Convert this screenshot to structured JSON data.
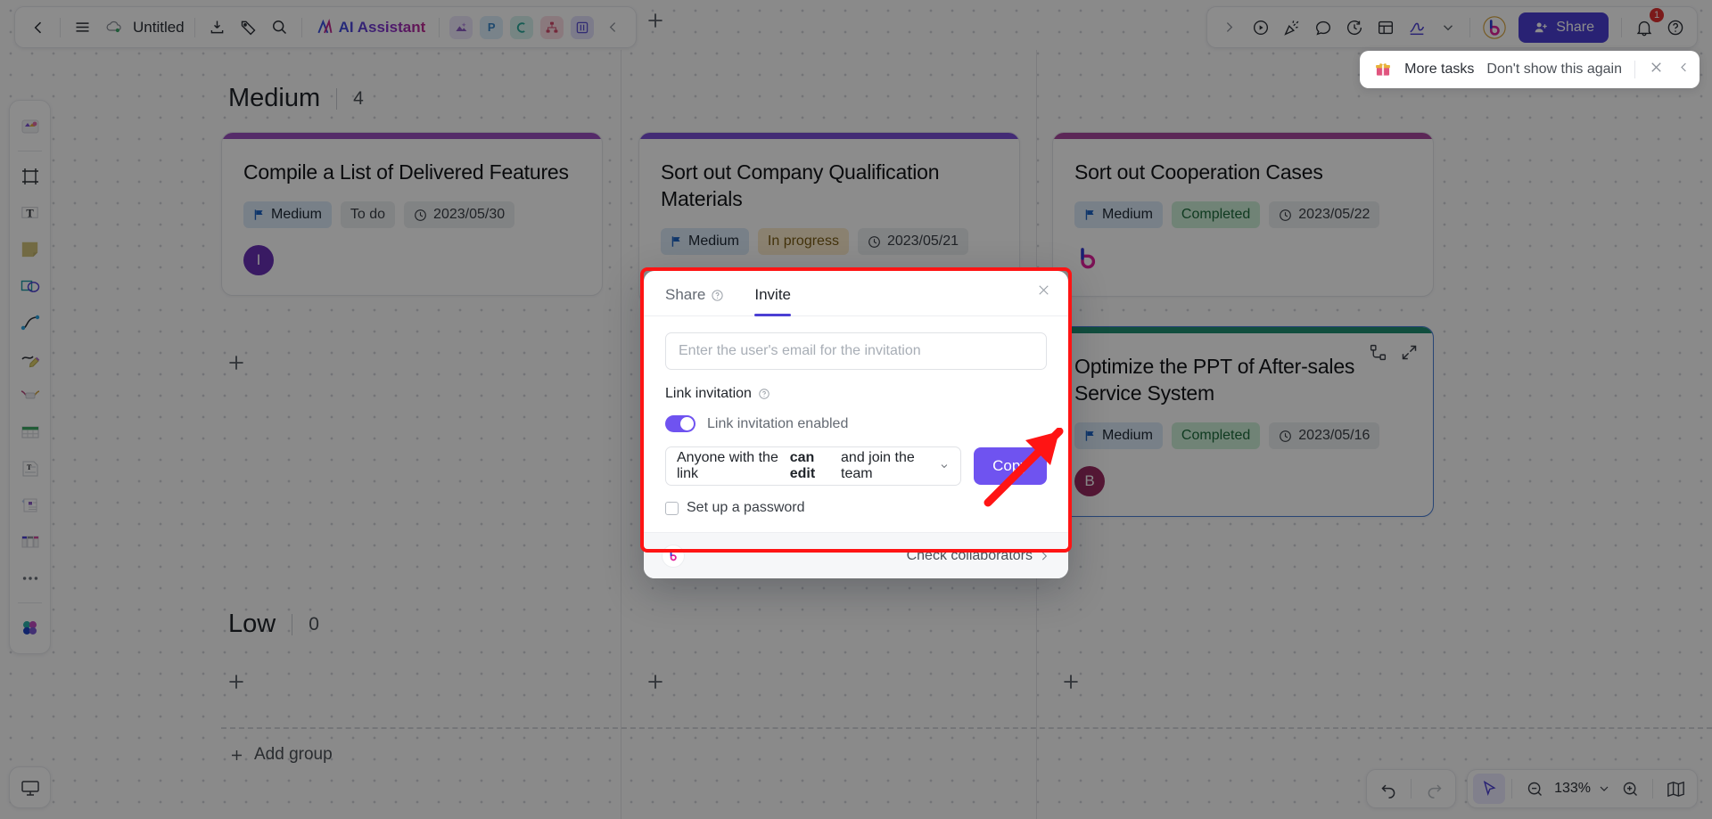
{
  "app": {
    "title": "Untitled",
    "zoom_level": "133%"
  },
  "topbar_left": {
    "back_icon": "chevron-left-icon",
    "menu_icon": "hamburger-menu-icon",
    "cloud_icon": "cloud-saved-icon",
    "title": "Untitled",
    "download_icon": "download-icon",
    "tag_icon": "tag-icon",
    "search_icon": "search-icon",
    "ai_label": "AI Assistant",
    "apps": [
      {
        "name": "image-app",
        "glyph": "▲",
        "bg": "#ede7fb",
        "fg": "#7a4fd1"
      },
      {
        "name": "ppt-app",
        "glyph": "P",
        "bg": "#ddeffb",
        "fg": "#3a86c8"
      },
      {
        "name": "mind-app",
        "glyph": "C",
        "bg": "#d8f2ee",
        "fg": "#2aa89a"
      },
      {
        "name": "flow-app",
        "glyph": "∴",
        "bg": "#fbdde4",
        "fg": "#d1496b"
      },
      {
        "name": "board-app",
        "glyph": "▥",
        "bg": "#e2e1fb",
        "fg": "#5a4fd4"
      }
    ],
    "collapse_icon": "chevron-left-icon"
  },
  "topbar_right": {
    "expand_icon": "chevron-right-icon",
    "icons": [
      {
        "name": "present-play-icon"
      },
      {
        "name": "celebrate-icon"
      },
      {
        "name": "comment-icon"
      },
      {
        "name": "history-icon"
      },
      {
        "name": "template-icon"
      },
      {
        "name": "pen-signature-icon"
      },
      {
        "name": "chevron-down-icon"
      }
    ],
    "brand_icon": "boardmix-logo-icon",
    "share_label": "Share",
    "share_icon": "person-add-icon",
    "notification_icon": "bell-icon",
    "notification_count": "1",
    "help_icon": "question-help-icon"
  },
  "toast": {
    "gift_icon": "gift-icon",
    "label": "More tasks",
    "dismiss_label": "Don't show this again",
    "close_icon": "close-icon"
  },
  "rail": {
    "items": [
      {
        "name": "tool-assets"
      },
      {
        "name": "tool-frame"
      },
      {
        "name": "tool-text"
      },
      {
        "name": "tool-sticky-note"
      },
      {
        "name": "tool-shape"
      },
      {
        "name": "tool-connector"
      },
      {
        "name": "tool-pen"
      },
      {
        "name": "tool-ribbon"
      },
      {
        "name": "tool-table"
      },
      {
        "name": "tool-document"
      },
      {
        "name": "tool-note-card"
      },
      {
        "name": "tool-layout"
      },
      {
        "name": "tool-more"
      },
      {
        "name": "tool-color-palette"
      }
    ],
    "bottom_item": {
      "name": "tool-presentation"
    }
  },
  "board": {
    "groups": [
      {
        "name": "Medium",
        "count": "4"
      },
      {
        "name": "Low",
        "count": "0"
      }
    ],
    "add_group_label": "Add group",
    "cards": [
      {
        "id": "compile-list",
        "title": "Compile a List of Delivered Features",
        "accent": "#9b4fbf",
        "priority": "Medium",
        "status": "To do",
        "status_kind": "todo",
        "date": "2023/05/30",
        "avatar": {
          "initial": "I",
          "bg": "#6930b5"
        }
      },
      {
        "id": "sort-qualification",
        "title": "Sort out Company Qualification Materials",
        "accent": "#7a4fd6",
        "priority": "Medium",
        "status": "In progress",
        "status_kind": "prog",
        "date": "2023/05/21",
        "avatar": null
      },
      {
        "id": "sort-cooperation",
        "title": "Sort out Cooperation Cases",
        "accent": "#a8489e",
        "priority": "Medium",
        "status": "Completed",
        "status_kind": "done",
        "date": "2023/05/22",
        "avatar": null
      },
      {
        "id": "optimize-ppt",
        "title": "Optimize the PPT of After-sales Service System",
        "accent": "#1f8f72",
        "priority": "Medium",
        "status": "Completed",
        "status_kind": "done",
        "date": "2023/05/16",
        "avatar": {
          "initial": "B",
          "bg": "#9c2a62"
        },
        "selected": true,
        "icons": [
          "relation-icon",
          "expand-icon"
        ]
      }
    ]
  },
  "modal": {
    "tab_share": "Share",
    "tab_share_icon": "question-help-icon",
    "tab_invite": "Invite",
    "close_icon": "close-icon",
    "email_placeholder": "Enter the user's email for the invitation",
    "email_value": "",
    "link_invitation_label": "Link invitation",
    "link_invitation_help_icon": "question-help-icon",
    "toggle_state": "on",
    "toggle_label": "Link invitation enabled",
    "permission_prefix": "Anyone with the link",
    "permission_value": "can edit",
    "permission_suffix": "and join the team",
    "permission_caret_icon": "chevron-down-icon",
    "copy_label": "Copy",
    "password_label": "Set up a password",
    "password_checked": false,
    "footer_brand_icon": "boardmix-logo-icon",
    "footer_link": "Check collaborators",
    "footer_link_icon": "chevron-right-icon",
    "highlight_color": "#ff1414",
    "accent_color": "#6f53f0"
  },
  "bottom_tools": {
    "undo_icon": "undo-icon",
    "redo_icon": "redo-icon",
    "cursor_icon": "cursor-pointer-icon",
    "zoom_out_icon": "zoom-out-icon",
    "zoom_value": "133%",
    "zoom_caret_icon": "chevron-down-icon",
    "zoom_in_icon": "zoom-in-icon",
    "minimap_icon": "minimap-icon"
  }
}
